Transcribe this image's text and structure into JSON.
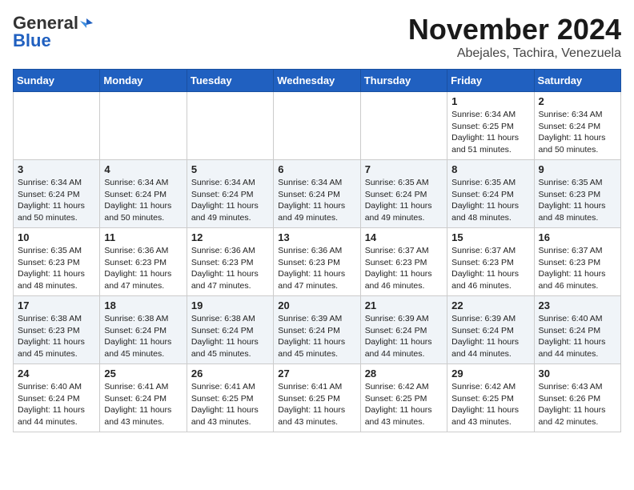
{
  "header": {
    "logo_general": "General",
    "logo_blue": "Blue",
    "month_title": "November 2024",
    "location": "Abejales, Tachira, Venezuela"
  },
  "days_of_week": [
    "Sunday",
    "Monday",
    "Tuesday",
    "Wednesday",
    "Thursday",
    "Friday",
    "Saturday"
  ],
  "weeks": [
    [
      {
        "day": "",
        "info": ""
      },
      {
        "day": "",
        "info": ""
      },
      {
        "day": "",
        "info": ""
      },
      {
        "day": "",
        "info": ""
      },
      {
        "day": "",
        "info": ""
      },
      {
        "day": "1",
        "info": "Sunrise: 6:34 AM\nSunset: 6:25 PM\nDaylight: 11 hours and 51 minutes."
      },
      {
        "day": "2",
        "info": "Sunrise: 6:34 AM\nSunset: 6:24 PM\nDaylight: 11 hours and 50 minutes."
      }
    ],
    [
      {
        "day": "3",
        "info": "Sunrise: 6:34 AM\nSunset: 6:24 PM\nDaylight: 11 hours and 50 minutes."
      },
      {
        "day": "4",
        "info": "Sunrise: 6:34 AM\nSunset: 6:24 PM\nDaylight: 11 hours and 50 minutes."
      },
      {
        "day": "5",
        "info": "Sunrise: 6:34 AM\nSunset: 6:24 PM\nDaylight: 11 hours and 49 minutes."
      },
      {
        "day": "6",
        "info": "Sunrise: 6:34 AM\nSunset: 6:24 PM\nDaylight: 11 hours and 49 minutes."
      },
      {
        "day": "7",
        "info": "Sunrise: 6:35 AM\nSunset: 6:24 PM\nDaylight: 11 hours and 49 minutes."
      },
      {
        "day": "8",
        "info": "Sunrise: 6:35 AM\nSunset: 6:24 PM\nDaylight: 11 hours and 48 minutes."
      },
      {
        "day": "9",
        "info": "Sunrise: 6:35 AM\nSunset: 6:23 PM\nDaylight: 11 hours and 48 minutes."
      }
    ],
    [
      {
        "day": "10",
        "info": "Sunrise: 6:35 AM\nSunset: 6:23 PM\nDaylight: 11 hours and 48 minutes."
      },
      {
        "day": "11",
        "info": "Sunrise: 6:36 AM\nSunset: 6:23 PM\nDaylight: 11 hours and 47 minutes."
      },
      {
        "day": "12",
        "info": "Sunrise: 6:36 AM\nSunset: 6:23 PM\nDaylight: 11 hours and 47 minutes."
      },
      {
        "day": "13",
        "info": "Sunrise: 6:36 AM\nSunset: 6:23 PM\nDaylight: 11 hours and 47 minutes."
      },
      {
        "day": "14",
        "info": "Sunrise: 6:37 AM\nSunset: 6:23 PM\nDaylight: 11 hours and 46 minutes."
      },
      {
        "day": "15",
        "info": "Sunrise: 6:37 AM\nSunset: 6:23 PM\nDaylight: 11 hours and 46 minutes."
      },
      {
        "day": "16",
        "info": "Sunrise: 6:37 AM\nSunset: 6:23 PM\nDaylight: 11 hours and 46 minutes."
      }
    ],
    [
      {
        "day": "17",
        "info": "Sunrise: 6:38 AM\nSunset: 6:23 PM\nDaylight: 11 hours and 45 minutes."
      },
      {
        "day": "18",
        "info": "Sunrise: 6:38 AM\nSunset: 6:24 PM\nDaylight: 11 hours and 45 minutes."
      },
      {
        "day": "19",
        "info": "Sunrise: 6:38 AM\nSunset: 6:24 PM\nDaylight: 11 hours and 45 minutes."
      },
      {
        "day": "20",
        "info": "Sunrise: 6:39 AM\nSunset: 6:24 PM\nDaylight: 11 hours and 45 minutes."
      },
      {
        "day": "21",
        "info": "Sunrise: 6:39 AM\nSunset: 6:24 PM\nDaylight: 11 hours and 44 minutes."
      },
      {
        "day": "22",
        "info": "Sunrise: 6:39 AM\nSunset: 6:24 PM\nDaylight: 11 hours and 44 minutes."
      },
      {
        "day": "23",
        "info": "Sunrise: 6:40 AM\nSunset: 6:24 PM\nDaylight: 11 hours and 44 minutes."
      }
    ],
    [
      {
        "day": "24",
        "info": "Sunrise: 6:40 AM\nSunset: 6:24 PM\nDaylight: 11 hours and 44 minutes."
      },
      {
        "day": "25",
        "info": "Sunrise: 6:41 AM\nSunset: 6:24 PM\nDaylight: 11 hours and 43 minutes."
      },
      {
        "day": "26",
        "info": "Sunrise: 6:41 AM\nSunset: 6:25 PM\nDaylight: 11 hours and 43 minutes."
      },
      {
        "day": "27",
        "info": "Sunrise: 6:41 AM\nSunset: 6:25 PM\nDaylight: 11 hours and 43 minutes."
      },
      {
        "day": "28",
        "info": "Sunrise: 6:42 AM\nSunset: 6:25 PM\nDaylight: 11 hours and 43 minutes."
      },
      {
        "day": "29",
        "info": "Sunrise: 6:42 AM\nSunset: 6:25 PM\nDaylight: 11 hours and 43 minutes."
      },
      {
        "day": "30",
        "info": "Sunrise: 6:43 AM\nSunset: 6:26 PM\nDaylight: 11 hours and 42 minutes."
      }
    ]
  ]
}
